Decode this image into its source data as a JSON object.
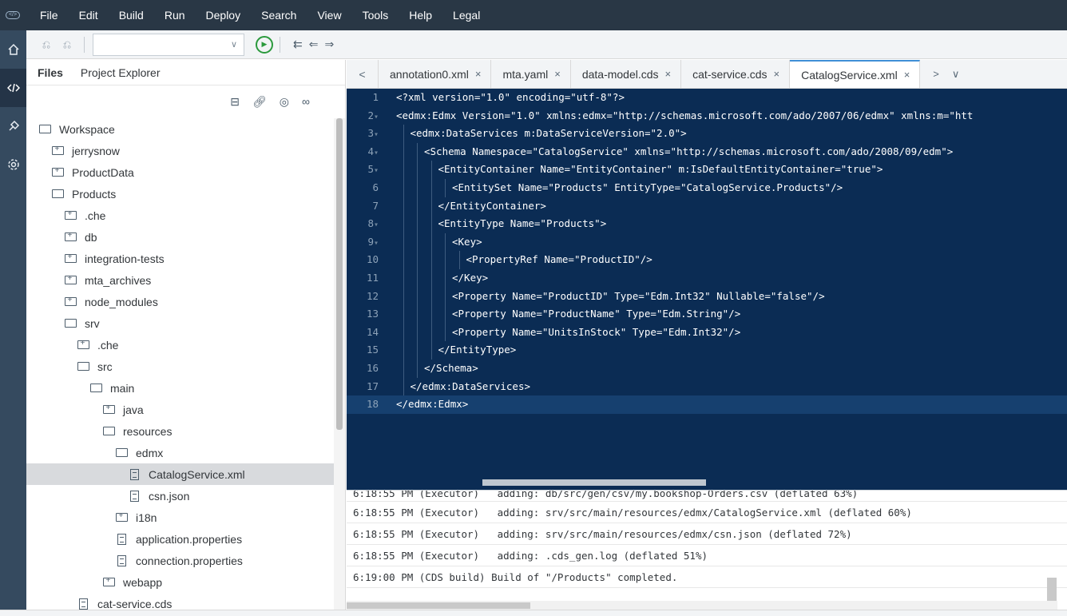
{
  "logo": "</>",
  "menu": [
    "File",
    "Edit",
    "Build",
    "Run",
    "Deploy",
    "Search",
    "View",
    "Tools",
    "Help",
    "Legal"
  ],
  "leftbar_icons": [
    "home-icon",
    "code-icon",
    "plugin-icon",
    "settings-icon"
  ],
  "toolbar": {
    "icons": [
      "undo-icon",
      "redo-icon"
    ],
    "run_config_value": "",
    "run_glyph": "▶",
    "nav_glyphs": [
      "⇇",
      "⇐",
      "⇒"
    ]
  },
  "file_panel": {
    "tabs": [
      "Files",
      "Project Explorer"
    ],
    "tool_icons": [
      "collapse-icon",
      "link-icon",
      "hide-icon",
      "glasses-icon"
    ],
    "tree": [
      {
        "label": "Workspace",
        "type": "folder-open",
        "depth": 0
      },
      {
        "label": "jerrysnow",
        "type": "folder-closed",
        "depth": 1
      },
      {
        "label": "ProductData",
        "type": "folder-closed",
        "depth": 1
      },
      {
        "label": "Products",
        "type": "folder-open",
        "depth": 1
      },
      {
        "label": ".che",
        "type": "folder-closed",
        "depth": 2
      },
      {
        "label": "db",
        "type": "folder-closed",
        "depth": 2
      },
      {
        "label": "integration-tests",
        "type": "folder-closed",
        "depth": 2
      },
      {
        "label": "mta_archives",
        "type": "folder-closed",
        "depth": 2
      },
      {
        "label": "node_modules",
        "type": "folder-closed",
        "depth": 2
      },
      {
        "label": "srv",
        "type": "folder-open",
        "depth": 2
      },
      {
        "label": ".che",
        "type": "folder-closed",
        "depth": 3
      },
      {
        "label": "src",
        "type": "folder-open",
        "depth": 3
      },
      {
        "label": "main",
        "type": "folder-open",
        "depth": 4
      },
      {
        "label": "java",
        "type": "folder-closed",
        "depth": 5
      },
      {
        "label": "resources",
        "type": "folder-open",
        "depth": 5
      },
      {
        "label": "edmx",
        "type": "folder-open",
        "depth": 6
      },
      {
        "label": "CatalogService.xml",
        "type": "file",
        "depth": 7,
        "selected": true
      },
      {
        "label": "csn.json",
        "type": "file",
        "depth": 7
      },
      {
        "label": "i18n",
        "type": "folder-closed",
        "depth": 6
      },
      {
        "label": "application.properties",
        "type": "file",
        "depth": 6
      },
      {
        "label": "connection.properties",
        "type": "file",
        "depth": 6
      },
      {
        "label": "webapp",
        "type": "folder-closed",
        "depth": 5
      },
      {
        "label": "cat-service.cds",
        "type": "file",
        "depth": 3
      }
    ]
  },
  "editor": {
    "tab_prev": "<",
    "tab_next": ">",
    "tab_menu": "∨",
    "tabs": [
      {
        "label": "annotation0.xml",
        "active": false
      },
      {
        "label": "mta.yaml",
        "active": false
      },
      {
        "label": "data-model.cds",
        "active": false
      },
      {
        "label": "cat-service.cds",
        "active": false
      },
      {
        "label": "CatalogService.xml",
        "active": true
      }
    ],
    "close_glyph": "×",
    "lines": [
      {
        "n": "1",
        "fold": "",
        "indent": 0,
        "text": "<?xml version=\"1.0\" encoding=\"utf-8\"?>"
      },
      {
        "n": "2",
        "fold": "▾",
        "indent": 0,
        "text": "<edmx:Edmx Version=\"1.0\" xmlns:edmx=\"http://schemas.microsoft.com/ado/2007/06/edmx\" xmlns:m=\"htt"
      },
      {
        "n": "3",
        "fold": "▾",
        "indent": 1,
        "text": "<edmx:DataServices m:DataServiceVersion=\"2.0\">"
      },
      {
        "n": "4",
        "fold": "▾",
        "indent": 2,
        "text": "<Schema Namespace=\"CatalogService\" xmlns=\"http://schemas.microsoft.com/ado/2008/09/edm\">"
      },
      {
        "n": "5",
        "fold": "▾",
        "indent": 3,
        "text": "<EntityContainer Name=\"EntityContainer\" m:IsDefaultEntityContainer=\"true\">"
      },
      {
        "n": "6",
        "fold": "",
        "indent": 4,
        "text": "<EntitySet Name=\"Products\" EntityType=\"CatalogService.Products\"/>"
      },
      {
        "n": "7",
        "fold": "",
        "indent": 3,
        "text": "</EntityContainer>"
      },
      {
        "n": "8",
        "fold": "▾",
        "indent": 3,
        "text": "<EntityType Name=\"Products\">"
      },
      {
        "n": "9",
        "fold": "▾",
        "indent": 4,
        "text": "<Key>"
      },
      {
        "n": "10",
        "fold": "",
        "indent": 5,
        "text": "<PropertyRef Name=\"ProductID\"/>"
      },
      {
        "n": "11",
        "fold": "",
        "indent": 4,
        "text": "</Key>"
      },
      {
        "n": "12",
        "fold": "",
        "indent": 4,
        "text": "<Property Name=\"ProductID\" Type=\"Edm.Int32\" Nullable=\"false\"/>"
      },
      {
        "n": "13",
        "fold": "",
        "indent": 4,
        "text": "<Property Name=\"ProductName\" Type=\"Edm.String\"/>"
      },
      {
        "n": "14",
        "fold": "",
        "indent": 4,
        "text": "<Property Name=\"UnitsInStock\" Type=\"Edm.Int32\"/>"
      },
      {
        "n": "15",
        "fold": "",
        "indent": 3,
        "text": "</EntityType>"
      },
      {
        "n": "16",
        "fold": "",
        "indent": 2,
        "text": "</Schema>"
      },
      {
        "n": "17",
        "fold": "",
        "indent": 1,
        "text": "</edmx:DataServices>"
      },
      {
        "n": "18",
        "fold": "",
        "indent": 0,
        "text": "</edmx:Edmx>",
        "current": true
      }
    ]
  },
  "console": {
    "lines": [
      "6:18:55 PM (Executor)   adding: db/src/gen/csv/my.bookshop-Orders.csv (deflated 63%)",
      "6:18:55 PM (Executor)   adding: srv/src/main/resources/edmx/CatalogService.xml (deflated 60%)",
      "6:18:55 PM (Executor)   adding: srv/src/main/resources/edmx/csn.json (deflated 72%)",
      "6:18:55 PM (Executor)   adding: .cds_gen.log (deflated 51%)",
      "6:19:00 PM (CDS build) Build of \"/Products\" completed."
    ]
  },
  "colors": {
    "menubar_bg": "#293745",
    "leftbar_bg": "#354a5f",
    "editor_bg": "#0b2c54",
    "editor_current_line": "#16406f",
    "active_tab_accent": "#3f8fd6",
    "run_green": "#2b9a3d",
    "selected_row": "#d8dadd"
  }
}
